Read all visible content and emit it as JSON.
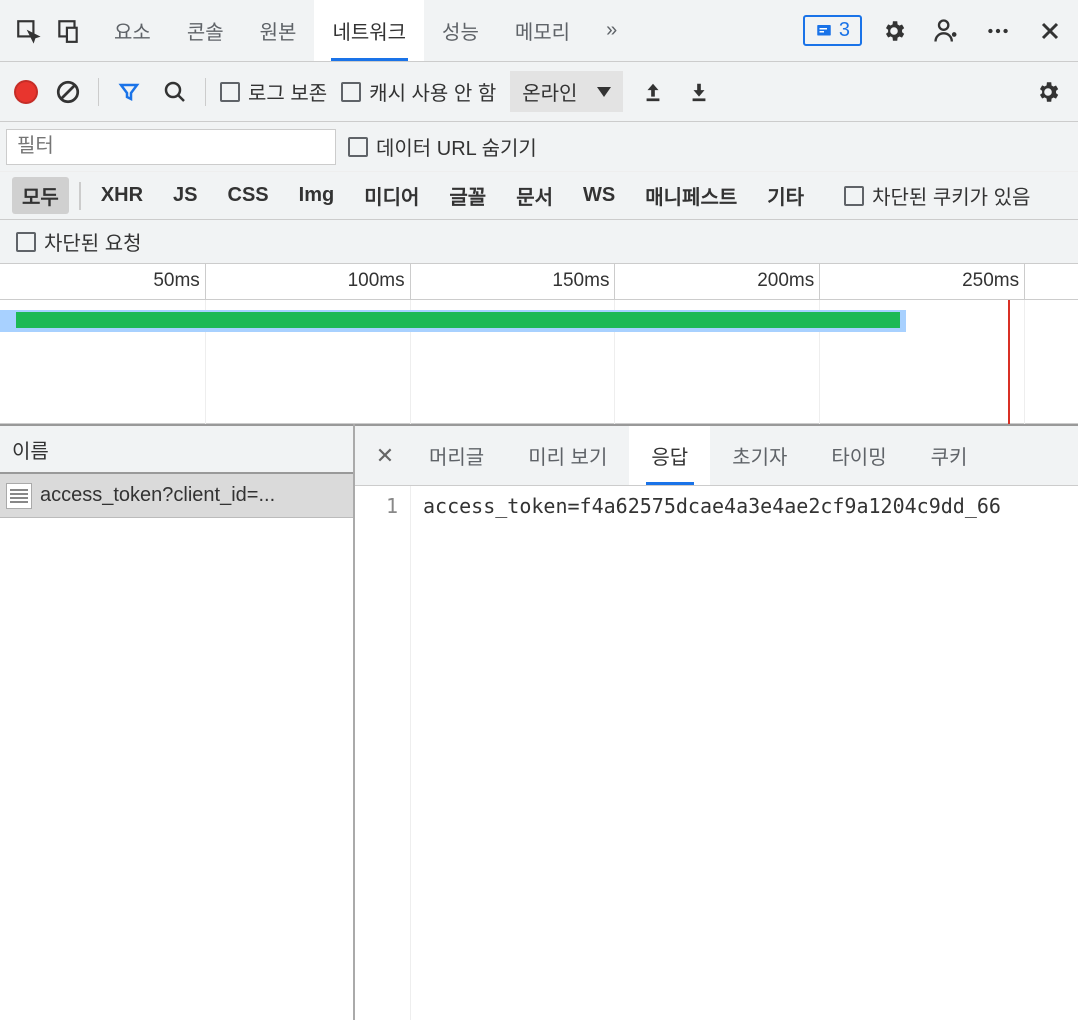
{
  "topTabs": {
    "items": [
      "요소",
      "콘솔",
      "원본",
      "네트워크",
      "성능",
      "메모리"
    ],
    "activeIndex": 3,
    "overflow": "»",
    "badgeCount": "3"
  },
  "toolbar": {
    "preserveLog": "로그 보존",
    "disableCache": "캐시 사용 안 함",
    "throttling": "온라인"
  },
  "filterBar": {
    "filterPlaceholder": "필터",
    "hideDataUrls": "데이터 URL 숨기기"
  },
  "typeFilters": {
    "items": [
      "모두",
      "XHR",
      "JS",
      "CSS",
      "Img",
      "미디어",
      "글꼴",
      "문서",
      "WS",
      "매니페스트",
      "기타"
    ],
    "selectedIndex": 0,
    "blockedCookies": "차단된 쿠키가 있음",
    "blockedRequests": "차단된 요청"
  },
  "timeline": {
    "ticks": [
      "50ms",
      "100ms",
      "150ms",
      "200ms",
      "250ms"
    ]
  },
  "requestList": {
    "header": "이름",
    "rows": [
      {
        "name": "access_token?client_id=..."
      }
    ]
  },
  "detail": {
    "tabs": [
      "머리글",
      "미리 보기",
      "응답",
      "초기자",
      "타이밍",
      "쿠키"
    ],
    "activeIndex": 2,
    "response": {
      "lineNumber": "1",
      "content": "access_token=f4a62575dcae4a3e4ae2cf9a1204c9dd_66"
    }
  }
}
